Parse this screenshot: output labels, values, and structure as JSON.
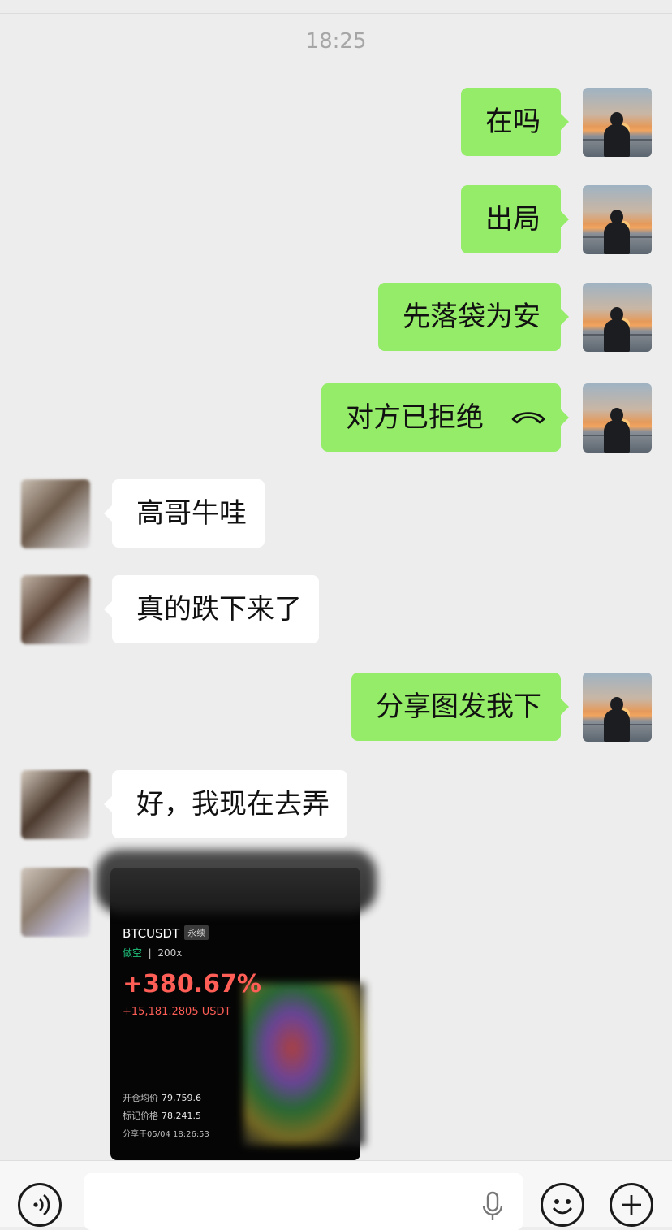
{
  "chat": {
    "time": "18:25",
    "messages": [
      {
        "dir": "out",
        "text": "在吗"
      },
      {
        "dir": "out",
        "text": "出局"
      },
      {
        "dir": "out",
        "text": "先落袋为安"
      },
      {
        "dir": "out",
        "text": "对方已拒绝",
        "icon": "hang-up-icon"
      },
      {
        "dir": "in",
        "text": "高哥牛哇"
      },
      {
        "dir": "in",
        "text": "真的跌下来了"
      },
      {
        "dir": "out",
        "text": "分享图发我下"
      },
      {
        "dir": "in",
        "text": "好，我现在去弄"
      }
    ],
    "shared_image": {
      "pair": "BTCUSDT",
      "tag": "永续",
      "side": "做空",
      "leverage": "200x",
      "pnl_pct": "+380.67%",
      "pnl_amount": "+15,181.2805 USDT",
      "open_price_label": "开仓均价",
      "open_price": "79,759.6",
      "mark_price_label": "标记价格",
      "mark_price": "78,241.5",
      "shared_at": "分享于05/04 18:26:53"
    }
  },
  "input_bar": {
    "icons": [
      "voice-icon",
      "mic-icon",
      "emoji-icon",
      "plus-icon"
    ]
  },
  "colors": {
    "background": "#ededed",
    "outgoing_bubble": "#95ec69",
    "incoming_bubble": "#ffffff",
    "pnl_red": "#ff5e57",
    "short_green": "#1fbf7a"
  }
}
